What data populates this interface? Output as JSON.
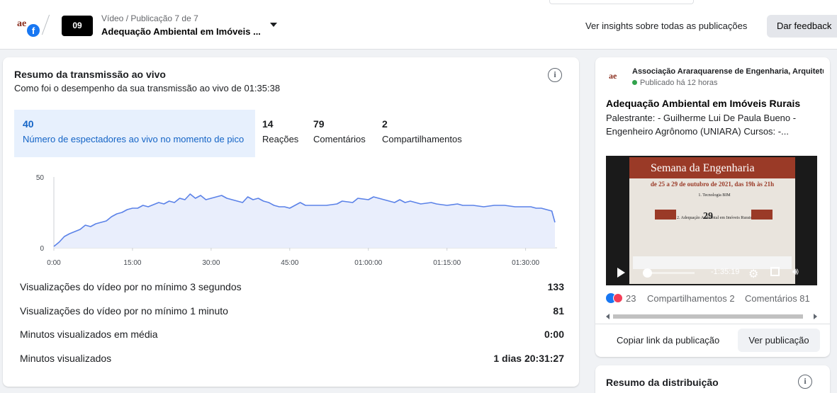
{
  "header": {
    "breadcrumb": "Vídeo / Publicação 7 de 7",
    "post_title": "Adequação Ambiental em Imóveis ...",
    "thumb_label": "09",
    "insights_link": "Ver insights sobre todas as publicações",
    "feedback_button": "Dar feedback"
  },
  "live_summary": {
    "title": "Resumo da transmissão ao vivo",
    "subtitle": "Como foi o desempenho da sua transmissão ao vivo de 01:35:38",
    "tabs": [
      {
        "value": "40",
        "label": "Número de espectadores ao vivo no momento de pico"
      },
      {
        "value": "14",
        "label": "Reações"
      },
      {
        "value": "79",
        "label": "Comentários"
      },
      {
        "value": "2",
        "label": "Compartilhamentos"
      }
    ],
    "metrics": [
      {
        "label": "Visualizações do vídeo por no mínimo 3 segundos",
        "value": "133"
      },
      {
        "label": "Visualizações do vídeo por no mínimo 1 minuto",
        "value": "81"
      },
      {
        "label": "Minutos visualizados em média",
        "value": "0:00"
      },
      {
        "label": "Minutos visualizados",
        "value": "1 dias 20:31:27"
      }
    ]
  },
  "chart_data": {
    "type": "area",
    "title": "",
    "xlabel": "",
    "ylabel": "",
    "x_ticks": [
      "0:00",
      "15:00",
      "30:00",
      "45:00",
      "01:00:00",
      "01:15:00",
      "01:30:00"
    ],
    "y_ticks": [
      "0",
      "50"
    ],
    "ylim": [
      0,
      50
    ],
    "xlim_minutes": [
      0,
      96
    ],
    "grid": true,
    "color": "#5b82e8",
    "fill": "#e9eefc",
    "series": [
      {
        "x_minutes": [
          0,
          1,
          2,
          3,
          5,
          6,
          7,
          8,
          10,
          11,
          12,
          13,
          14,
          15,
          16,
          17,
          18,
          20,
          21,
          22,
          23,
          24,
          25,
          26,
          27,
          28,
          29,
          30,
          31,
          32,
          33,
          34,
          35,
          36,
          37,
          38,
          39,
          40,
          41,
          42,
          43,
          44,
          45,
          46,
          47,
          48,
          50,
          52,
          54,
          55,
          57,
          58,
          60,
          61,
          62,
          63,
          64,
          65,
          66,
          67,
          68,
          70,
          72,
          73,
          75,
          77,
          78,
          80,
          82,
          84,
          86,
          88,
          90,
          91,
          92,
          93,
          94,
          95,
          95.6
        ],
        "values": [
          1,
          4,
          8,
          10,
          13,
          16,
          15,
          17,
          19,
          22,
          24,
          25,
          27,
          28,
          28,
          30,
          29,
          32,
          31,
          33,
          32,
          35,
          34,
          38,
          35,
          37,
          34,
          35,
          36,
          37,
          35,
          34,
          33,
          32,
          36,
          34,
          35,
          33,
          32,
          30,
          29,
          29,
          28,
          30,
          32,
          30,
          30,
          30,
          31,
          33,
          32,
          35,
          34,
          36,
          35,
          34,
          33,
          32,
          34,
          32,
          33,
          31,
          32,
          31,
          30,
          31,
          30,
          30,
          29,
          30,
          30,
          29,
          29,
          29,
          28,
          28,
          27,
          26,
          18
        ]
      }
    ]
  },
  "post_preview": {
    "page_name": "Associação Araraquarense de Engenharia, Arquitetura",
    "published": "Publicado há 12 horas",
    "title": "Adequação Ambiental em Imóveis Rurais",
    "description": "Palestrante: - Guilherme Lui De Paula Bueno - Engenheiro Agrônomo (UNIARA) Cursos: -...",
    "video": {
      "poster_heading": "Semana da Engenharia",
      "poster_dates": "de 25 a 29 de outubro de 2021, das 19h às 21h",
      "poster_day": "29",
      "poster_items": [
        "1. Tecnologia BIM",
        "2. Adequação Ambiental em Imóveis Rurais"
      ],
      "time_remaining": "-1:35:19"
    },
    "reaction_count": "23",
    "shares": "Compartilhamentos 2",
    "comments": "Comentários 81",
    "copy_link": "Copiar link da publicação",
    "view_post": "Ver publicação"
  },
  "distribution": {
    "title": "Resumo da distribuição"
  }
}
